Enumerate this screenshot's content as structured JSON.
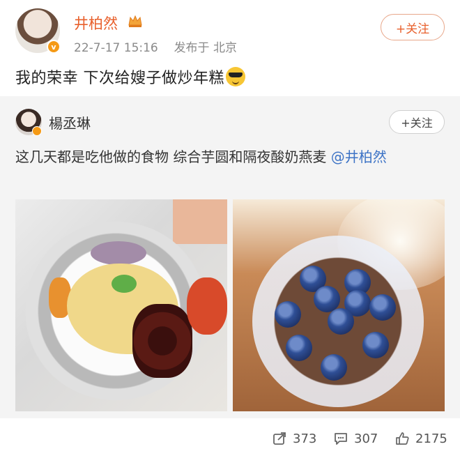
{
  "post": {
    "author": "井柏然",
    "timestamp": "22-7-17 15:16",
    "location": "发布于 北京",
    "follow_label": "+关注",
    "text": "我的荣幸 下次给嫂子做炒年糕",
    "emoji": "sunglasses-emoji"
  },
  "repost": {
    "author": "楊丞琳",
    "follow_label": "+关注",
    "text": "这几天都是吃他做的食物 综合芋圆和隔夜酸奶燕麦 ",
    "mention": "@井柏然",
    "images": [
      {
        "alt": "taro-yogurt-bowl"
      },
      {
        "alt": "blueberry-overnight-oats"
      }
    ]
  },
  "actions": {
    "repost_count": "373",
    "comment_count": "307",
    "like_count": "2175"
  },
  "colors": {
    "author_name": "#e8602c",
    "verified_badge": "#f59a16",
    "mention": "#3e74c6",
    "repost_bg": "#f4f4f4"
  }
}
